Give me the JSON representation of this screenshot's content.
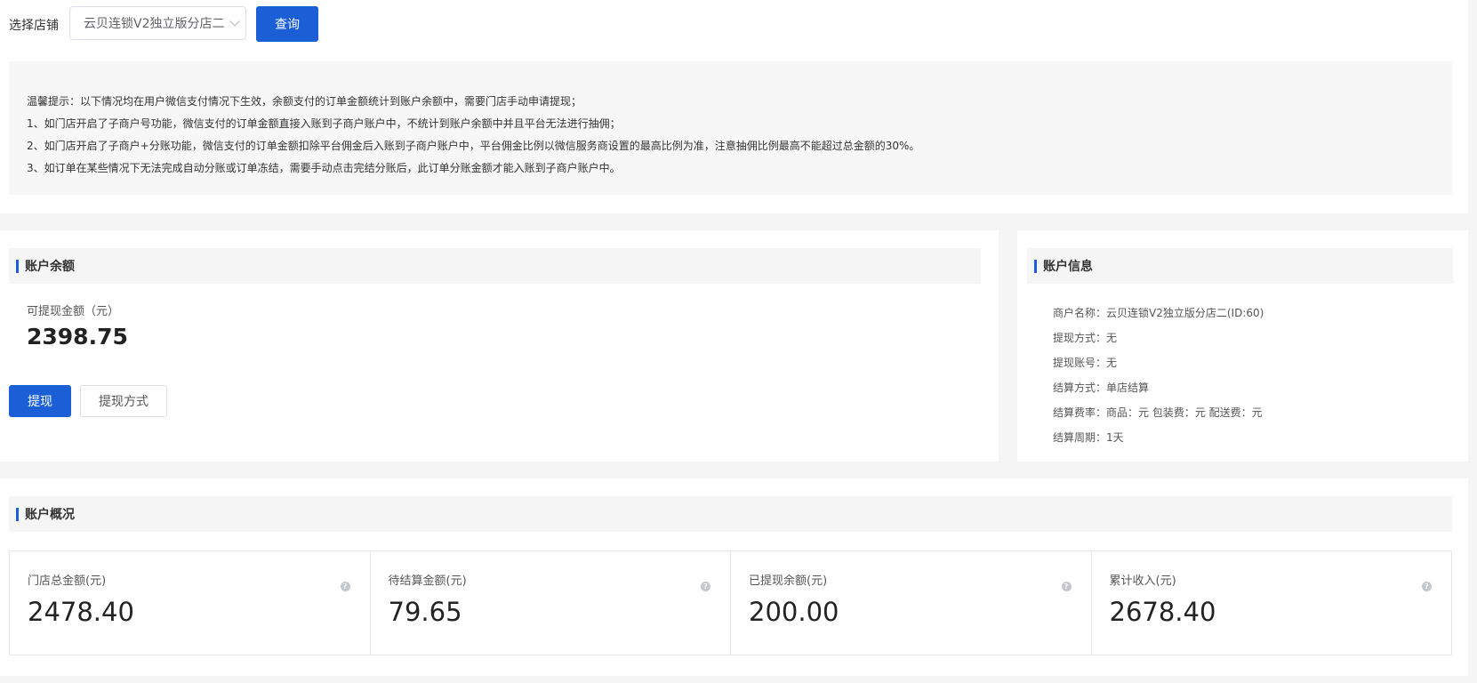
{
  "filter": {
    "store_label": "选择店铺",
    "store_value": "云贝连锁V2独立版分店二",
    "query_button": "查询"
  },
  "tips": [
    "温馨提示：以下情况均在用户微信支付情况下生效，余额支付的订单金额统计到账户余额中，需要门店手动申请提现；",
    "1、如门店开启了子商户号功能，微信支付的订单金额直接入账到子商户账户中，不统计到账户余额中并且平台无法进行抽佣；",
    "2、如门店开启了子商户+分账功能，微信支付的订单金额扣除平台佣金后入账到子商户账户中，平台佣金比例以微信服务商设置的最高比例为准，注意抽佣比例最高不能超过总金额的30%。",
    "3、如订单在某些情况下无法完成自动分账或订单冻结，需要手动点击完结分账后，此订单分账金额才能入账到子商户账户中。"
  ],
  "balance": {
    "title": "账户余额",
    "available_label": "可提现金额（元）",
    "available_value": "2398.75",
    "withdraw_button": "提现",
    "method_button": "提现方式"
  },
  "info": {
    "title": "账户信息",
    "rows": [
      "商户名称：云贝连锁V2独立版分店二(ID:60)",
      "提现方式：无",
      "提现账号：无",
      "结算方式：单店结算",
      "结算费率：商品：元 包装费：元 配送费：元",
      "结算周期：1天"
    ]
  },
  "overview": {
    "title": "账户概况",
    "stats": [
      {
        "label": "门店总金额(元)",
        "value": "2478.40"
      },
      {
        "label": "待结算金额(元)",
        "value": "79.65"
      },
      {
        "label": "已提现余额(元)",
        "value": "200.00"
      },
      {
        "label": "累计收入(元)",
        "value": "2678.40"
      }
    ],
    "help_icon": "?"
  },
  "colors": {
    "primary": "#1a5fd6",
    "page_bg": "#f5f5f5"
  }
}
